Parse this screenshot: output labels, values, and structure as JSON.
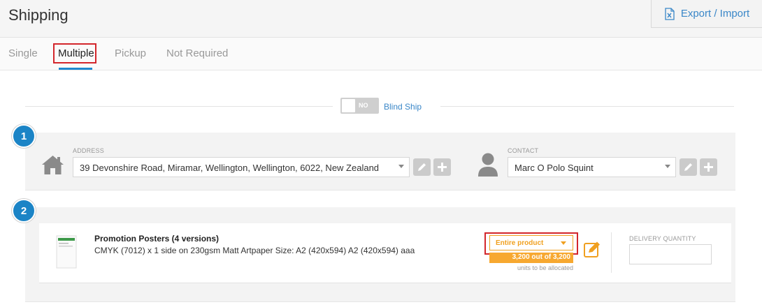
{
  "header": {
    "title": "Shipping",
    "export_label": "Export / Import"
  },
  "tabs": [
    {
      "label": "Single"
    },
    {
      "label": "Multiple"
    },
    {
      "label": "Pickup"
    },
    {
      "label": "Not Required"
    }
  ],
  "blind_ship": {
    "toggle_value": "NO",
    "label": "Blind Ship"
  },
  "step1": {
    "number": "1",
    "address": {
      "label": "ADDRESS",
      "value": "39 Devonshire Road, Miramar, Wellington, Wellington, 6022, New Zealand"
    },
    "contact": {
      "label": "CONTACT",
      "value": "Marc O Polo Squint"
    }
  },
  "step2": {
    "number": "2",
    "product": {
      "title": "Promotion Posters (4 versions)",
      "description": "CMYK (7012) x 1 side on 230gsm Matt Artpaper Size: A2 (420x594) A2 (420x594) aaa",
      "allocation_value": "Entire product",
      "allocated_text": "3,200 out of 3,200",
      "allocated_sub": "units to be allocated"
    },
    "delivery_quantity_label": "DELIVERY QUANTITY"
  },
  "colors": {
    "accent": "#1b84c6",
    "link": "#3a87c8",
    "highlight": "#d3262c",
    "allocation": "#f7a830"
  }
}
